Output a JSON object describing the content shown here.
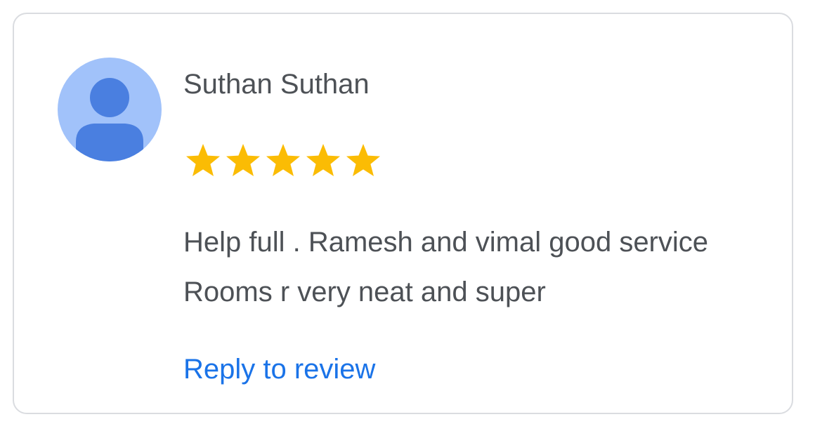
{
  "review": {
    "reviewer_name": "Suthan Suthan",
    "avatar_icon": "default-person-avatar-icon",
    "rating": 5,
    "rating_max": 5,
    "star_icon": "star-icon",
    "text_lines": [
      "Help full . Ramesh and vimal good service",
      "Rooms r very neat and super"
    ],
    "reply_label": "Reply to review"
  },
  "colors": {
    "avatar_bg": "#a1c2fa",
    "avatar_figure": "#4a7fe0",
    "star": "#fbbc04",
    "text": "#4d5156",
    "link": "#1a73e8",
    "border": "#dadce0"
  }
}
